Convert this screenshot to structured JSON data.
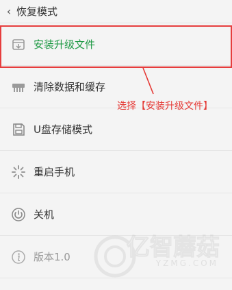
{
  "header": {
    "title": "恢复模式"
  },
  "menu": {
    "items": [
      {
        "label": "安装升级文件",
        "icon": "install-package-icon",
        "state": "selected"
      },
      {
        "label": "清除数据和缓存",
        "icon": "clear-data-icon",
        "state": "normal"
      },
      {
        "label": "U盘存储模式",
        "icon": "usb-storage-icon",
        "state": "normal"
      },
      {
        "label": "重启手机",
        "icon": "restart-icon",
        "state": "normal"
      },
      {
        "label": "关机",
        "icon": "power-icon",
        "state": "normal"
      },
      {
        "label": "版本1.0",
        "icon": "info-icon",
        "state": "disabled"
      }
    ]
  },
  "annotation": {
    "text": "选择【安装升级文件】",
    "color": "#e53935"
  },
  "watermark": {
    "text_cn": "亿智蘑菇",
    "text_en": "YZMG.COM"
  },
  "colors": {
    "selected_text": "#1f9a45",
    "highlight": "#e63d3d",
    "background": "#f4f4f4"
  }
}
